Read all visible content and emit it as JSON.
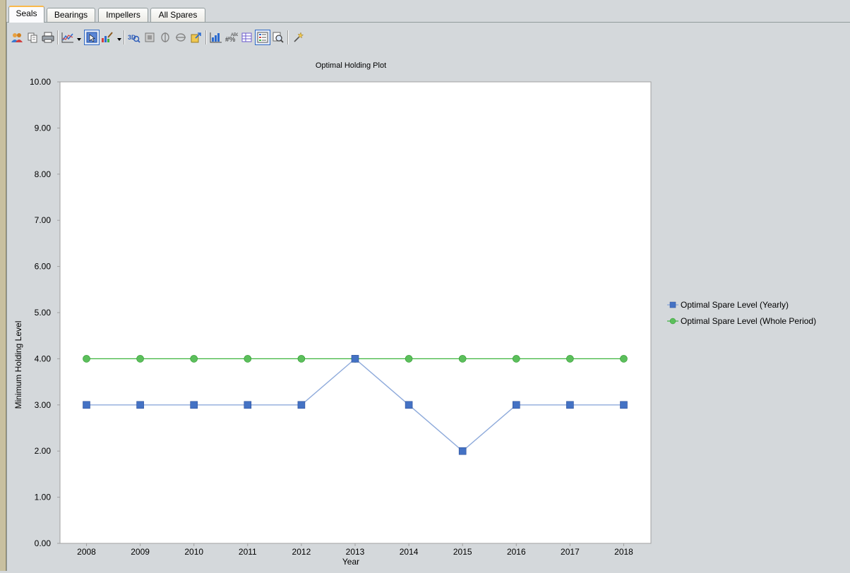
{
  "tabs": [
    "Seals",
    "Bearings",
    "Impellers",
    "All Spares"
  ],
  "active_tab": "Seals",
  "toolbar": {
    "icons": [
      "user-group-icon",
      "copy-icon",
      "print-icon",
      "chart-type-icon",
      "select-cursor-icon",
      "chart-palette-icon",
      "3d-icon",
      "border-icon",
      "rotate-horizontal-icon",
      "rotate-vertical-icon",
      "export-icon",
      "axis-settings-icon",
      "data-labels-icon",
      "data-editor-icon",
      "legend-icon",
      "zoom-icon",
      "wizard-icon"
    ]
  },
  "colors": {
    "series_yearly": "#4472c4",
    "series_yearly_line": "#8eaadb",
    "series_whole": "#5bbf5b",
    "series_whole_line": "#3cb43c"
  },
  "chart_data": {
    "type": "line",
    "title": "Optimal Holding Plot",
    "xlabel": "Year",
    "ylabel": "Minimum Holding Level",
    "categories": [
      "2008",
      "2009",
      "2010",
      "2011",
      "2012",
      "2013",
      "2014",
      "2015",
      "2016",
      "2017",
      "2018"
    ],
    "ylim": [
      0,
      10
    ],
    "yticks": [
      "0.00",
      "1.00",
      "2.00",
      "3.00",
      "4.00",
      "5.00",
      "6.00",
      "7.00",
      "8.00",
      "9.00",
      "10.00"
    ],
    "grid": false,
    "legend_position": "right",
    "series": [
      {
        "name": "Optimal Spare Level (Yearly)",
        "marker": "square",
        "values": [
          3,
          3,
          3,
          3,
          3,
          4,
          3,
          2,
          3,
          3,
          3
        ]
      },
      {
        "name": "Optimal Spare Level (Whole Period)",
        "marker": "circle",
        "values": [
          4,
          4,
          4,
          4,
          4,
          4,
          4,
          4,
          4,
          4,
          4
        ]
      }
    ]
  }
}
